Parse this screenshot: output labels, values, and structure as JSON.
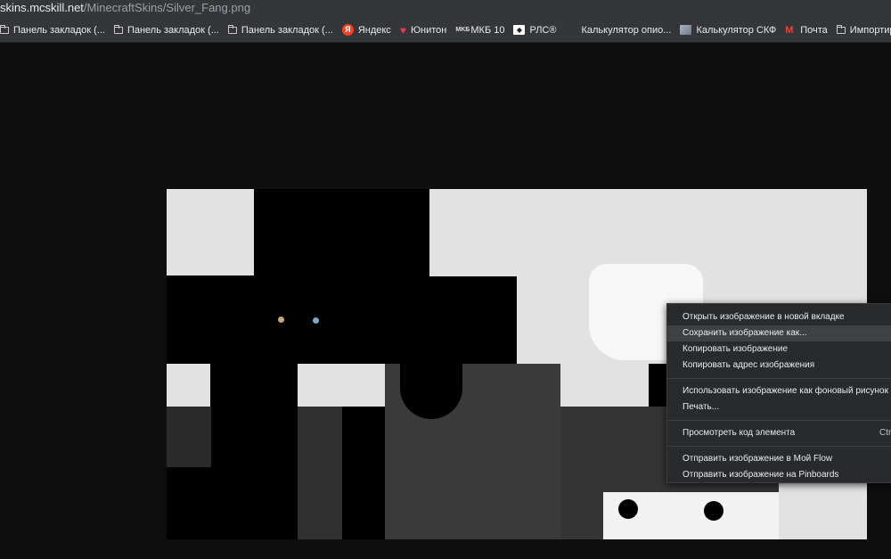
{
  "address_bar": {
    "domain": "skins.mcskill.net",
    "path": "/MinecraftSkins/Silver_Fang.png"
  },
  "bookmarks": [
    {
      "label": "Панель закладок (...",
      "icon": "folder-icon"
    },
    {
      "label": "Панель закладок (...",
      "icon": "folder-icon"
    },
    {
      "label": "Панель закладок (...",
      "icon": "folder-icon"
    },
    {
      "label": "Яндекс",
      "icon": "yandex-icon"
    },
    {
      "label": "Юнитон",
      "icon": "heart-icon"
    },
    {
      "label": "МКБ 10",
      "icon": "mkb-icon"
    },
    {
      "label": "РЛС®",
      "icon": "rls-icon"
    },
    {
      "label": "Калькулятор опио...",
      "icon": "none"
    },
    {
      "label": "Калькулятор СКФ",
      "icon": "image-icon"
    },
    {
      "label": "Почта",
      "icon": "gmail-icon"
    },
    {
      "label": "Импортировано и...",
      "icon": "folder-icon"
    }
  ],
  "context_menu": {
    "items": [
      {
        "label": "Открыть изображение в новой вкладке"
      },
      {
        "label": "Сохранить изображение как...",
        "highlighted": true
      },
      {
        "label": "Копировать изображение"
      },
      {
        "label": "Копировать адрес изображения"
      },
      {
        "label": "Использовать изображение как фоновый рисунок"
      },
      {
        "label": "Печать..."
      },
      {
        "label": "Просмотреть код элемента",
        "shortcut": "Ctrl"
      },
      {
        "label": "Отправить изображение в Мой Flow"
      },
      {
        "label": "Отправить изображение на Pinboards"
      }
    ]
  },
  "colors": {
    "page_background": "#0e0e0e",
    "toolbar": "#35363a",
    "menu_background": "#292a2d",
    "menu_highlight": "#3f4042",
    "skin_light_gray": "#e0e0e0",
    "skin_dark_gray": "#2c2c2c"
  }
}
